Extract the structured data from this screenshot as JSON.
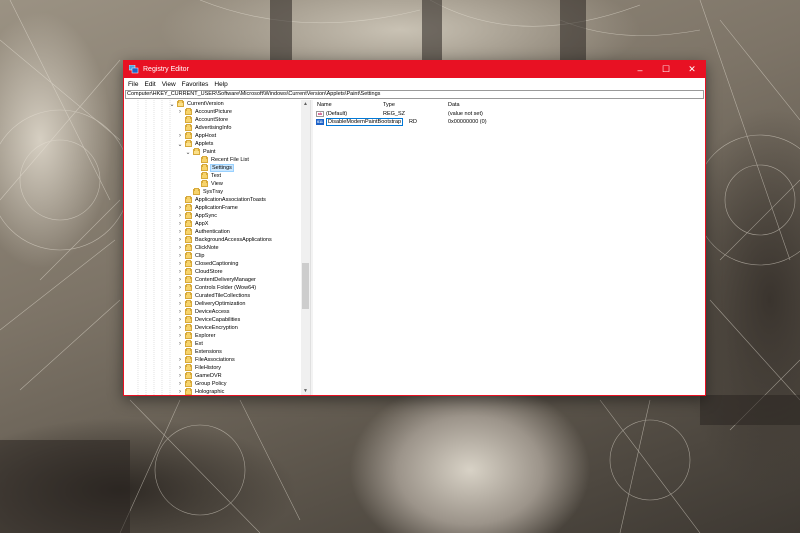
{
  "window": {
    "title": "Registry Editor",
    "accent": "#e81123",
    "controls": {
      "minimize": "–",
      "maximize": "☐",
      "close": "✕"
    }
  },
  "menu": [
    "File",
    "Edit",
    "View",
    "Favorites",
    "Help"
  ],
  "address": "Computer\\HKEY_CURRENT_USER\\Software\\Microsoft\\Windows\\CurrentVersion\\Applets\\Paint\\Settings",
  "tree": {
    "items": [
      {
        "label": "CurrentVersion",
        "expander": "⌄"
      },
      {
        "label": "AccountPicture",
        "expander": "›"
      },
      {
        "label": "AccountStore",
        "expander": ""
      },
      {
        "label": "AdvertisingInfo",
        "expander": ""
      },
      {
        "label": "AppHost",
        "expander": "›"
      },
      {
        "label": "Applets",
        "expander": "⌄"
      },
      {
        "label": "Paint",
        "expander": "⌄"
      },
      {
        "label": "Recent File List",
        "expander": ""
      },
      {
        "label": "Settings",
        "expander": "",
        "selected": true
      },
      {
        "label": "Text",
        "expander": ""
      },
      {
        "label": "View",
        "expander": ""
      },
      {
        "label": "SysTray",
        "expander": ""
      },
      {
        "label": "ApplicationAssociationToasts",
        "expander": ""
      },
      {
        "label": "ApplicationFrame",
        "expander": "›"
      },
      {
        "label": "AppSync",
        "expander": "›"
      },
      {
        "label": "AppX",
        "expander": "›"
      },
      {
        "label": "Authentication",
        "expander": "›"
      },
      {
        "label": "BackgroundAccessApplications",
        "expander": "›"
      },
      {
        "label": "ClickNote",
        "expander": "›"
      },
      {
        "label": "Clip",
        "expander": "›"
      },
      {
        "label": "ClosedCaptioning",
        "expander": "›"
      },
      {
        "label": "CloudStore",
        "expander": "›"
      },
      {
        "label": "ContentDeliveryManager",
        "expander": "›"
      },
      {
        "label": "Controls Folder (Wow64)",
        "expander": "›"
      },
      {
        "label": "CuratedTileCollections",
        "expander": "›"
      },
      {
        "label": "DeliveryOptimization",
        "expander": "›"
      },
      {
        "label": "DeviceAccess",
        "expander": "›"
      },
      {
        "label": "DeviceCapabilities",
        "expander": "›"
      },
      {
        "label": "DeviceEncryption",
        "expander": "›"
      },
      {
        "label": "Explorer",
        "expander": "›"
      },
      {
        "label": "Ext",
        "expander": "›"
      },
      {
        "label": "Extensions",
        "expander": ""
      },
      {
        "label": "FileAssociations",
        "expander": "›"
      },
      {
        "label": "FileHistory",
        "expander": "›"
      },
      {
        "label": "GameDVR",
        "expander": "›"
      },
      {
        "label": "Group Policy",
        "expander": "›"
      },
      {
        "label": "Holographic",
        "expander": "›"
      }
    ]
  },
  "values": {
    "columns": [
      "Name",
      "Type",
      "Data"
    ],
    "rows": [
      {
        "icon": "ab",
        "name": "(Default)",
        "type": "REG_SZ",
        "data": "(value not set)"
      },
      {
        "icon": "011",
        "name": "DisableModernPaintBootstrap",
        "type": "RD",
        "data": "0x00000000 (0)",
        "editing": true
      }
    ]
  }
}
